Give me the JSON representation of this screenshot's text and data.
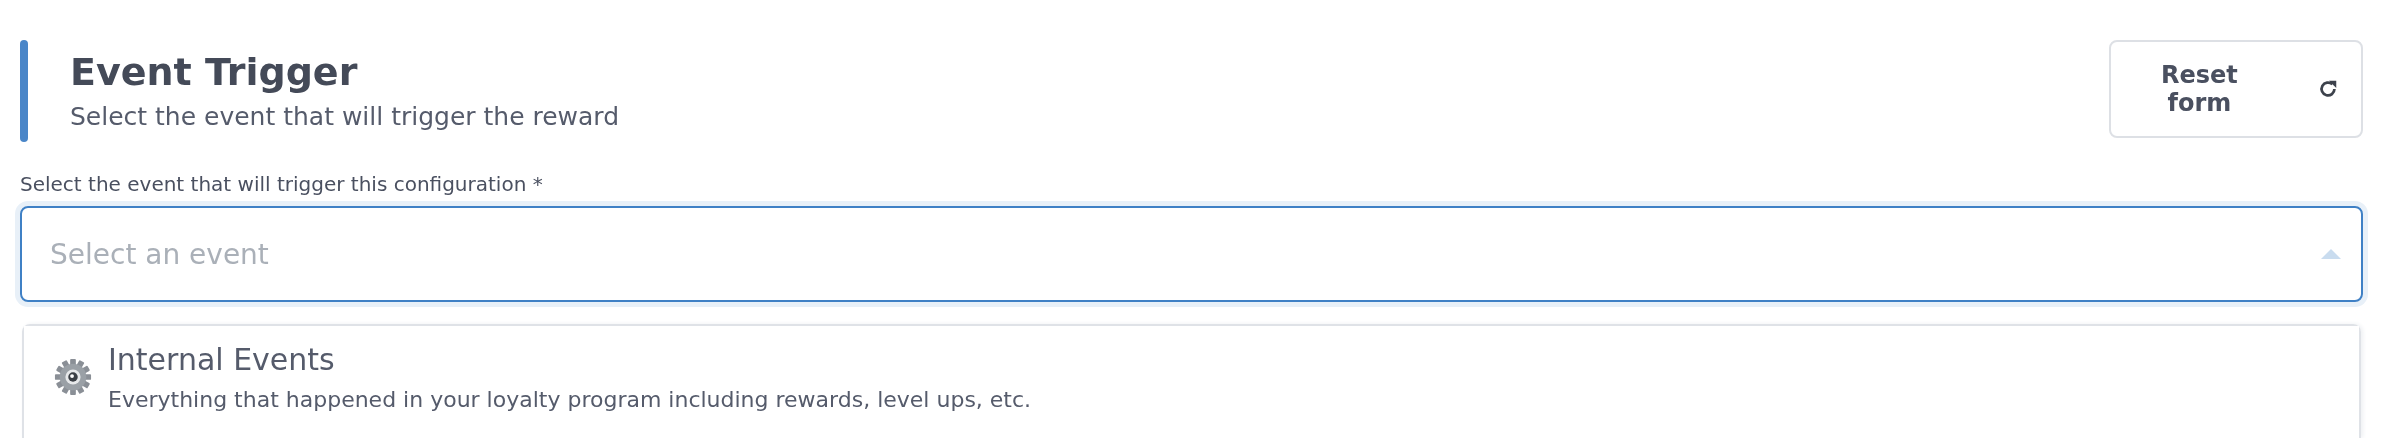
{
  "header": {
    "title": "Event Trigger",
    "subtitle": "Select the event that will trigger the reward"
  },
  "reset_button": {
    "label": "Reset\nform"
  },
  "event_select": {
    "label": "Select the event that will trigger this configuration",
    "required_mark": "*",
    "placeholder": "Select an event",
    "expanded": true
  },
  "options": [
    {
      "title": "Internal Events",
      "description": "Everything that happened in your loyalty program including rewards, level ups, etc.",
      "selected": false
    }
  ]
}
